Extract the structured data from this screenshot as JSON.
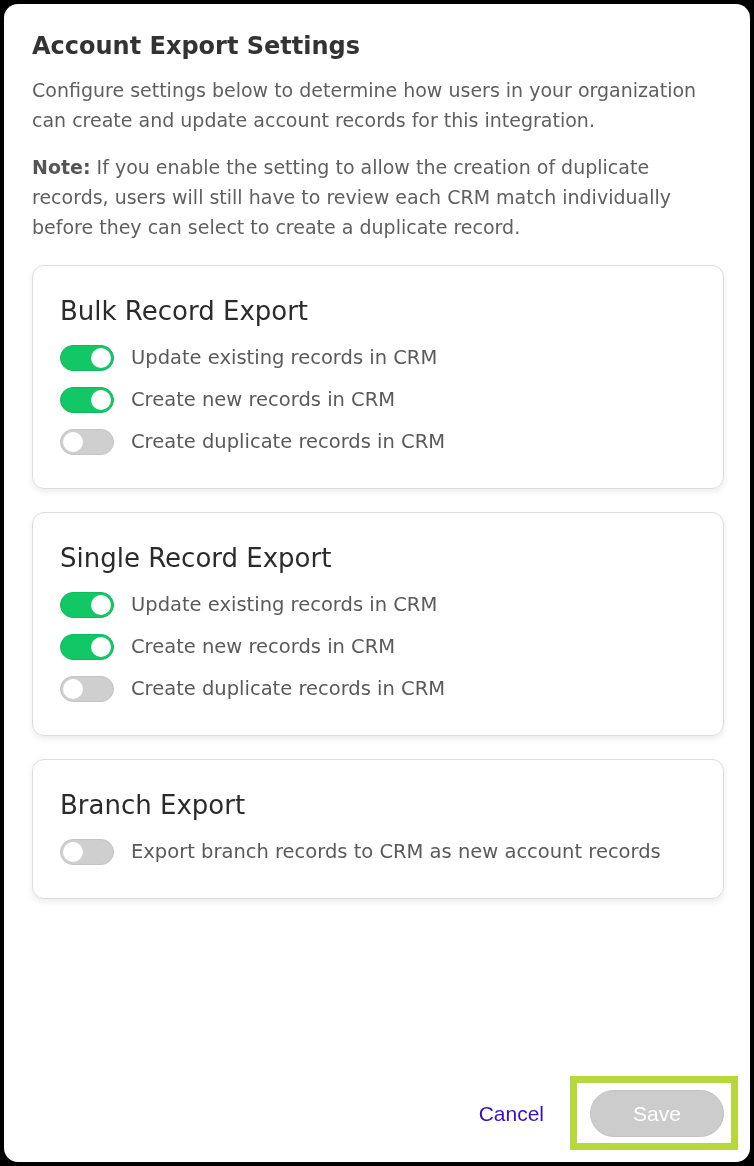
{
  "dialog": {
    "title": "Account Export Settings",
    "description": "Configure settings below to determine how users in your organization can create and update account records for this integration.",
    "note": "**Note:** If you enable the setting to allow the creation of duplicate records, users will still have to review each CRM match individually before they can select to create a duplicate record."
  },
  "sections": [
    {
      "title": "Bulk Record Export",
      "options": [
        {
          "label": "Update existing records in CRM",
          "on": true
        },
        {
          "label": "Create new records in CRM",
          "on": true
        },
        {
          "label": "Create duplicate records in CRM",
          "on": false
        }
      ]
    },
    {
      "title": "Single Record Export",
      "options": [
        {
          "label": "Update existing records in CRM",
          "on": true
        },
        {
          "label": "Create new records in CRM",
          "on": true
        },
        {
          "label": "Create duplicate records in CRM",
          "on": false
        }
      ]
    },
    {
      "title": "Branch Export",
      "options": [
        {
          "label": "Export branch records to CRM as new account records",
          "on": false
        }
      ]
    }
  ],
  "footer": {
    "cancel": "Cancel",
    "save": {
      "label": "Save",
      "disabled": true,
      "highlighted": true
    }
  }
}
